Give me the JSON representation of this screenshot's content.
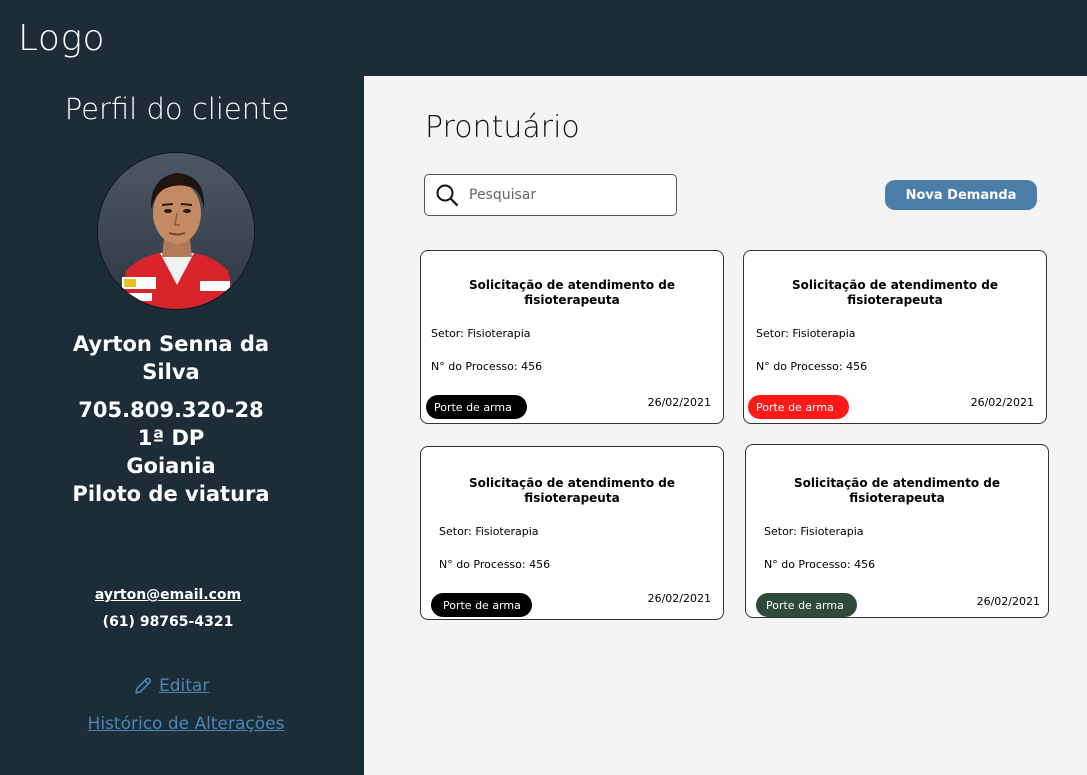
{
  "header": {
    "logo": "Logo"
  },
  "sidebar": {
    "title": "Perfil do cliente",
    "name": "Ayrton Senna da Silva",
    "cpf": "705.809.320-28",
    "dp": "1ª DP",
    "city": "Goiania",
    "role": "Piloto de viatura",
    "email": "ayrton@email.com",
    "phone": "(61) 98765-4321",
    "edit_label": "Editar",
    "history_label": "Histórico de Alterações"
  },
  "main": {
    "title": "Prontuário",
    "search_placeholder": "Pesquisar",
    "new_button": "Nova Demanda",
    "cards": [
      {
        "title": "Solicitação de atendimento de fisioterapeuta",
        "setor": "Setor: Fisioterapia",
        "processo": "N° do Processo: 456",
        "tag": "Porte de arma",
        "tag_color": "#000000",
        "date": "26/02/2021"
      },
      {
        "title": "Solicitação de atendimento de fisioterapeuta",
        "setor": "Setor: Fisioterapia",
        "processo": "N° do Processo: 456",
        "tag": "Porte de arma",
        "tag_color": "#ff1a1a",
        "date": "26/02/2021"
      },
      {
        "title": "Solicitação de atendimento de fisioterapeuta",
        "setor": "Setor: Fisioterapia",
        "processo": "N° do Processo: 456",
        "tag": "Porte de arma",
        "tag_color": "#000000",
        "date": "26/02/2021"
      },
      {
        "title": "Solicitação de atendimento de fisioterapeuta",
        "setor": "Setor: Fisioterapia",
        "processo": "N° do Processo: 456",
        "tag": "Porte de arma",
        "tag_color": "#2f4a38",
        "date": "26/02/2021"
      }
    ]
  },
  "colors": {
    "dark_bg": "#1c2d38",
    "content_bg": "#f4f4f4",
    "accent_blue": "#4a7ea8",
    "link_blue": "#4a86b5"
  }
}
